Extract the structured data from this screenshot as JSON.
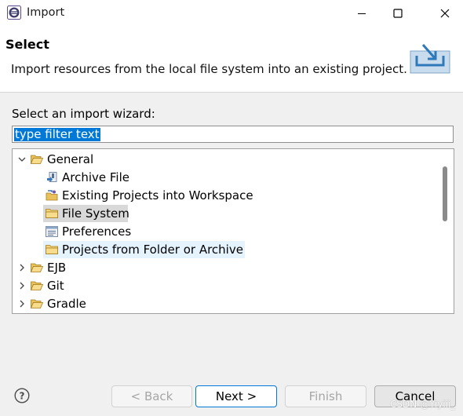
{
  "window": {
    "title": "Import",
    "controls": [
      "minimize-icon",
      "maximize-icon",
      "close-icon"
    ]
  },
  "header": {
    "title": "Select",
    "description": "Import resources from the local file system into an existing project."
  },
  "body": {
    "wizard_label": "Select an import wizard:",
    "filter": {
      "value": "type filter text"
    },
    "tree": [
      {
        "label": "General",
        "expanded": true,
        "icon": "folder-open-icon"
      },
      {
        "label": "Archive File",
        "icon": "archive-icon"
      },
      {
        "label": "Existing Projects into Workspace",
        "icon": "project-import-icon"
      },
      {
        "label": "File System",
        "icon": "folder-icon",
        "selected": true
      },
      {
        "label": "Preferences",
        "icon": "preferences-icon"
      },
      {
        "label": "Projects from Folder or Archive",
        "icon": "folder-icon"
      },
      {
        "label": "EJB",
        "expanded": false,
        "icon": "folder-icon"
      },
      {
        "label": "Git",
        "expanded": false,
        "icon": "folder-icon"
      },
      {
        "label": "Gradle",
        "expanded": false,
        "icon": "folder-icon"
      }
    ]
  },
  "buttons": {
    "back": "< Back",
    "next": "Next >",
    "finish": "Finish",
    "cancel": "Cancel"
  },
  "watermark": "CSDN @Yiyiii_",
  "colors": {
    "selection": "#0078d7",
    "folder": "#e8c15b"
  }
}
